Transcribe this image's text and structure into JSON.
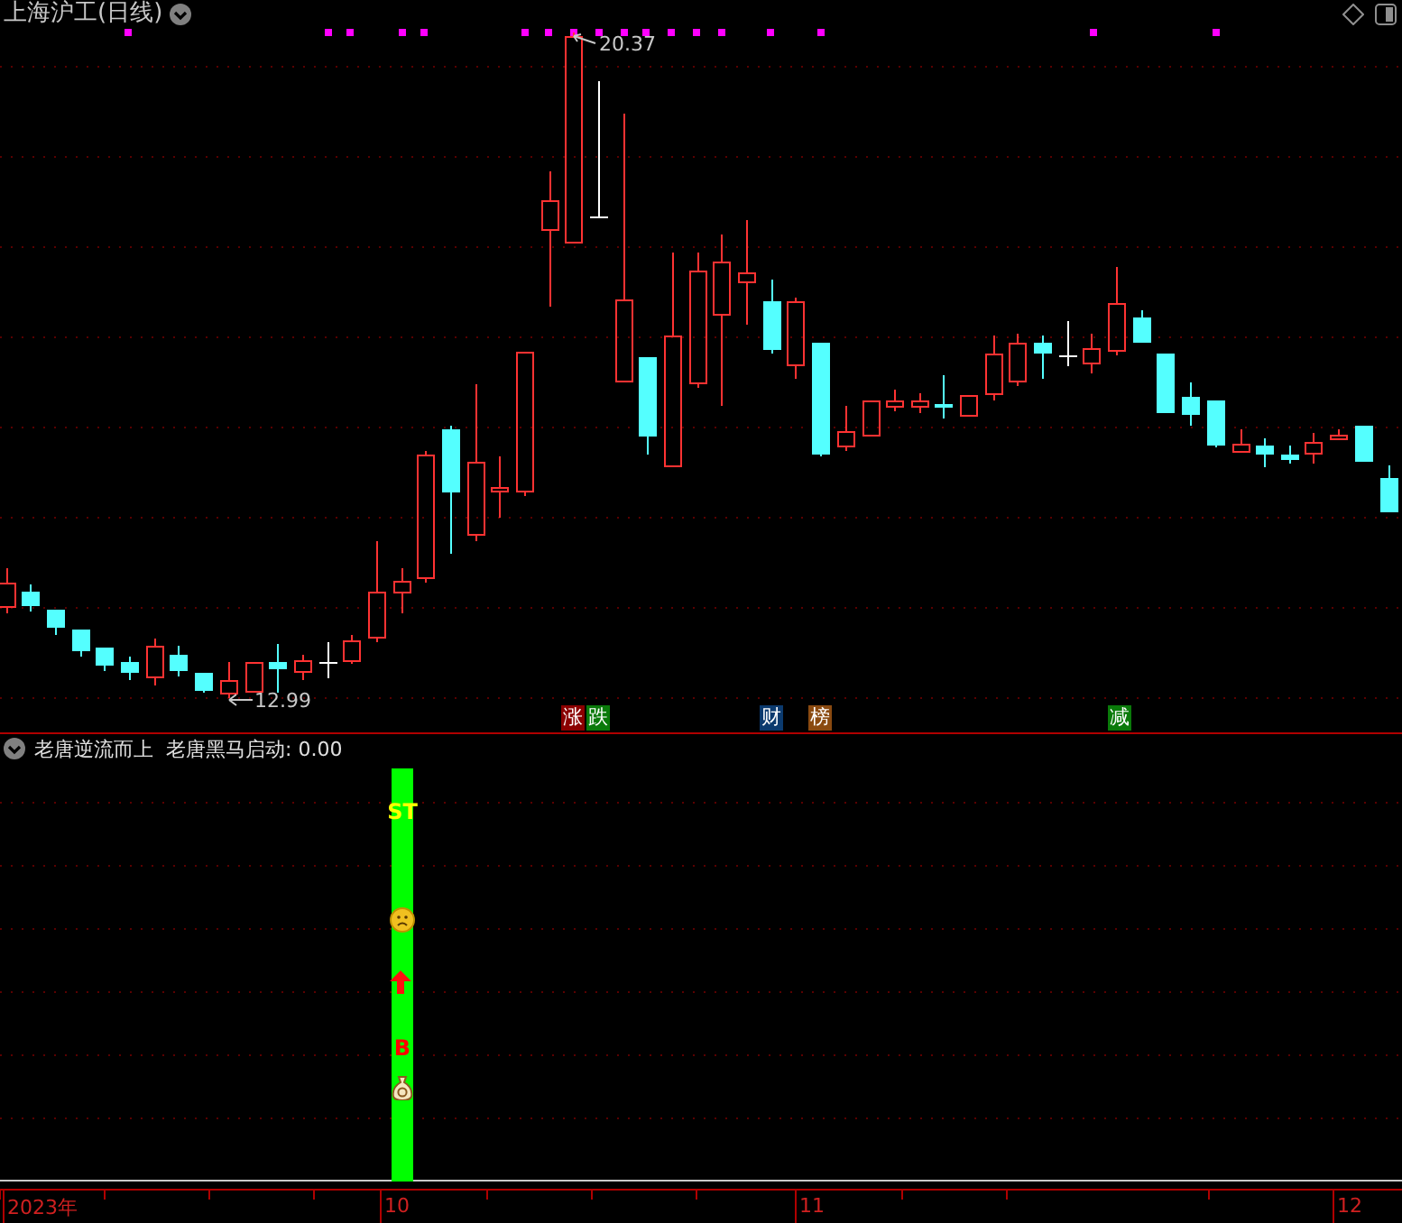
{
  "main_chart": {
    "title": "上海沪工(日线)",
    "high_label": "20.37",
    "low_label": "12.99",
    "event_badges": [
      {
        "text": "涨",
        "color": "#8b0000"
      },
      {
        "text": "跌",
        "color": "#0a7a0a"
      },
      {
        "text": "财",
        "color": "#0b3a6e"
      },
      {
        "text": "榜",
        "color": "#8a4a10"
      },
      {
        "text": "减",
        "color": "#0a7a0a"
      }
    ]
  },
  "indicator_panel": {
    "name": "老唐逆流而上",
    "reading": "老唐黑马启动: 0.00",
    "signals": [
      {
        "kind": "caution-text",
        "text": "ST"
      },
      {
        "kind": "sad-face"
      },
      {
        "kind": "up-arrow"
      },
      {
        "kind": "buy-text",
        "text": "B"
      },
      {
        "kind": "money-bag"
      }
    ]
  },
  "time_axis": [
    "2023年",
    "10",
    "11",
    "12"
  ]
}
